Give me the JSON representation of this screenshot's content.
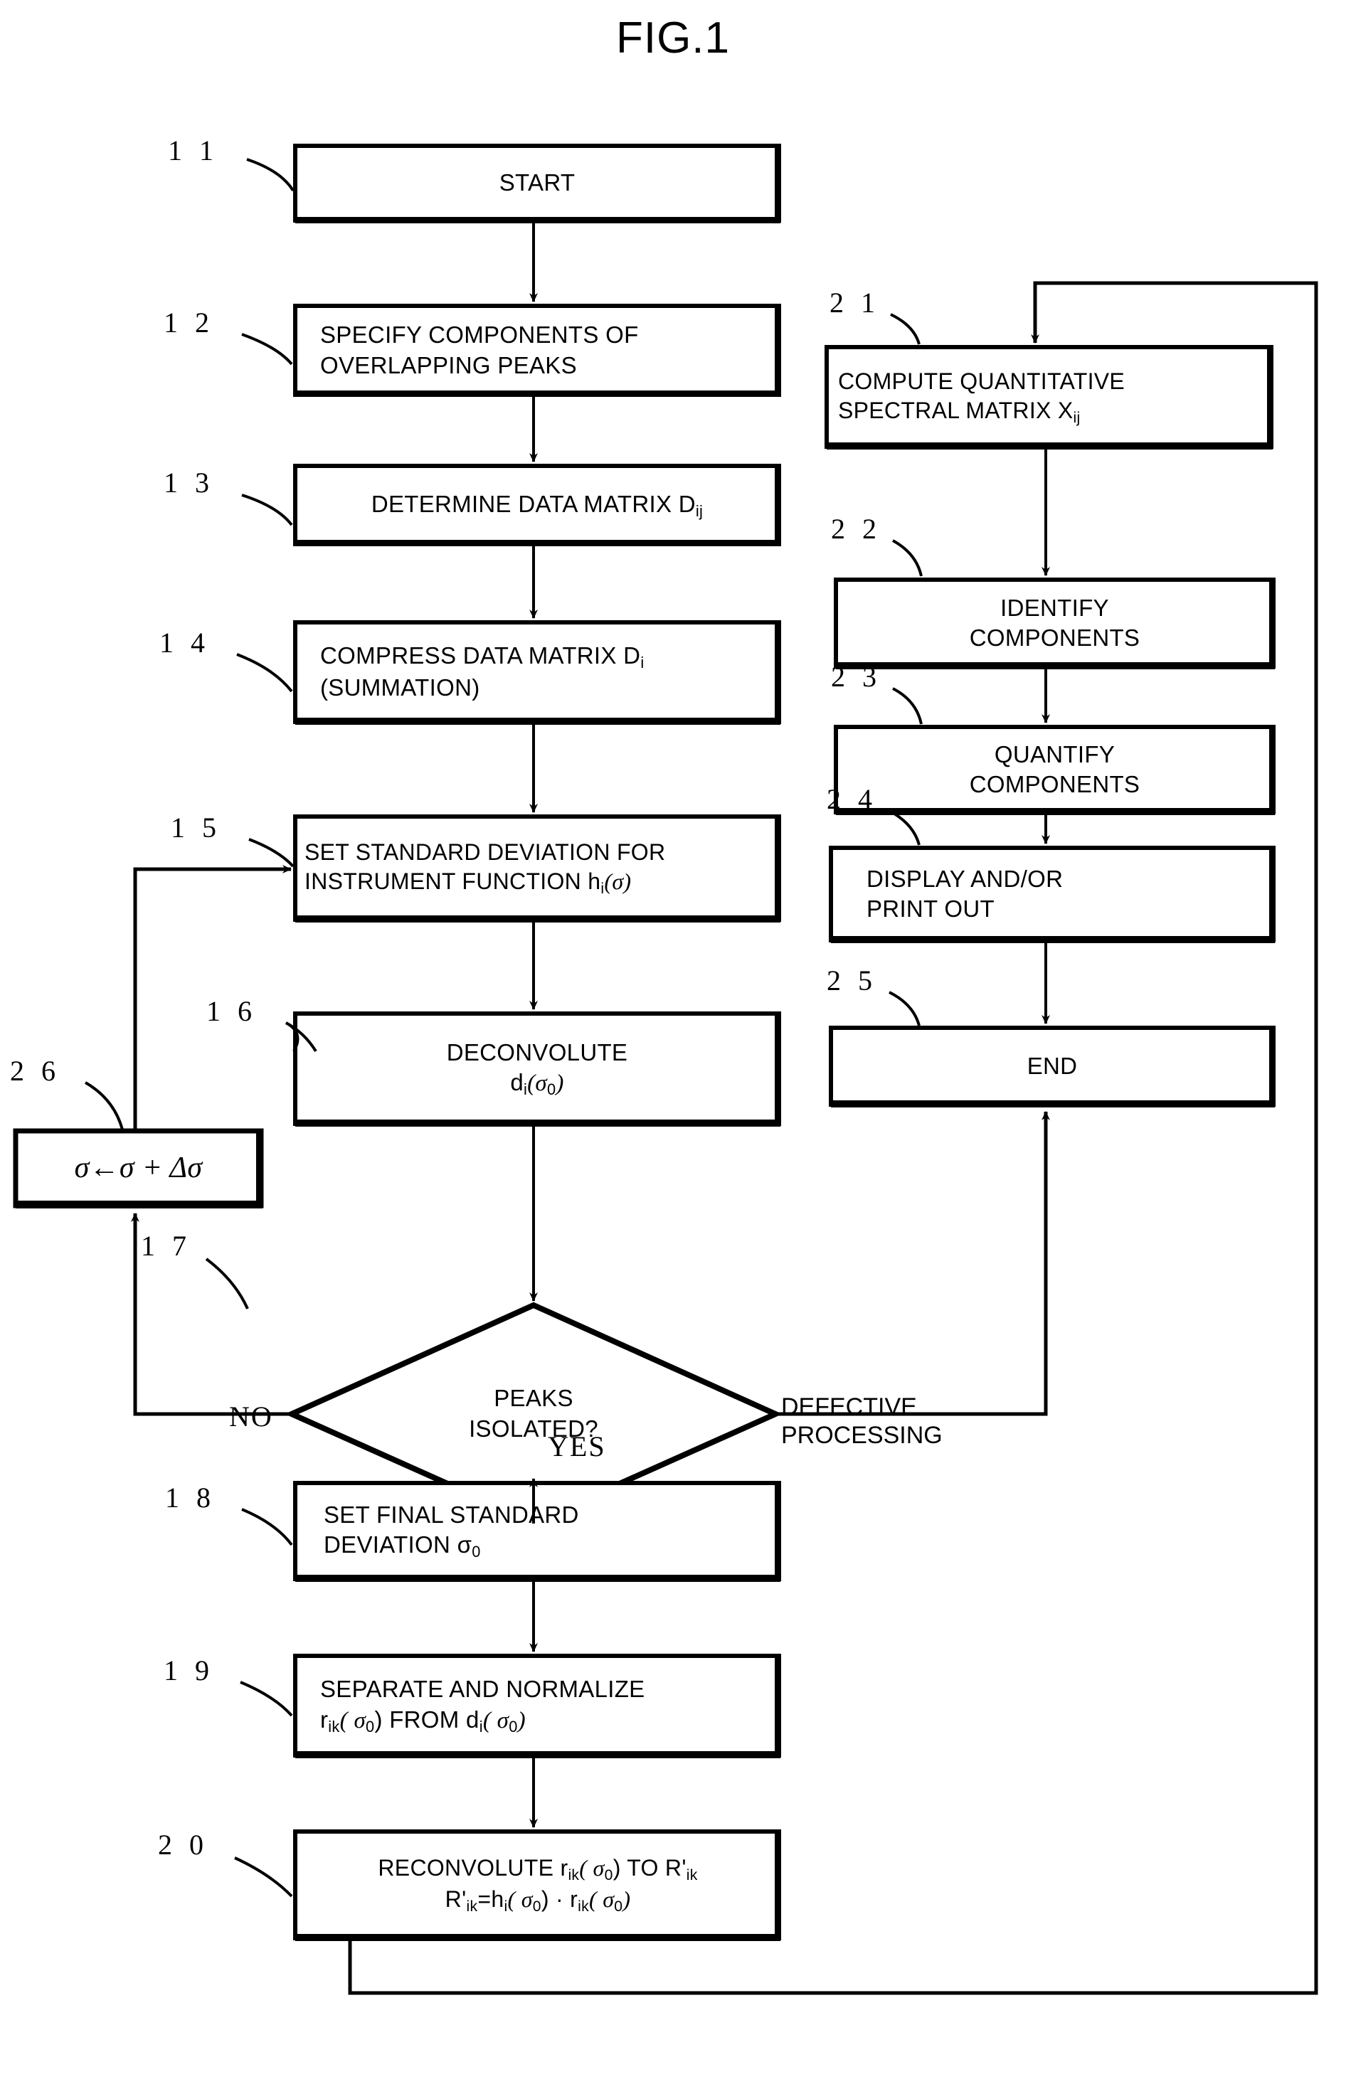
{
  "figure": {
    "title": "FIG.1",
    "type": "patent-flowchart"
  },
  "nodes": {
    "n11": {
      "ref": "1 1",
      "lines": [
        "START"
      ]
    },
    "n12": {
      "ref": "1 2",
      "lines": [
        "SPECIFY COMPONENTS OF",
        "OVERLAPPING PEAKS"
      ]
    },
    "n13": {
      "ref": "1 3",
      "lines": [
        "DETERMINE DATA MATRIX D",
        "ij"
      ]
    },
    "n14": {
      "ref": "1 4",
      "lines": [
        "COMPRESS DATA MATRIX D",
        "i",
        "(SUMMATION)"
      ]
    },
    "n15": {
      "ref": "1 5",
      "lines": [
        "SET STANDARD DEVIATION FOR",
        "INSTRUMENT FUNCTION h",
        "i",
        "(σ)"
      ]
    },
    "n16": {
      "ref": "1 6",
      "lines": [
        "DECONVOLUTE",
        "d",
        "i",
        "(σ",
        "0",
        ")"
      ]
    },
    "n17": {
      "ref": "1 7",
      "lines": [
        "PEAKS",
        "ISOLATED?"
      ]
    },
    "n18": {
      "ref": "1 8",
      "lines": [
        "SET FINAL STANDARD",
        "DEVIATION σ",
        "0"
      ]
    },
    "n19": {
      "ref": "1 9",
      "lines": [
        "SEPARATE AND NORMALIZE",
        "r",
        "ik",
        "( σ",
        "0",
        ") FROM d",
        "i",
        "( σ",
        "0",
        ")"
      ]
    },
    "n20": {
      "ref": "2 0",
      "lines": [
        "RECONVOLUTE r",
        "ik",
        "( σ",
        "0",
        ") TO R'",
        "ik",
        "R'",
        "ik",
        "=h",
        "i",
        "( σ",
        "0",
        ") · r",
        "ik",
        "( σ",
        "0",
        ")"
      ]
    },
    "n21": {
      "ref": "2 1",
      "lines": [
        "COMPUTE QUANTITATIVE",
        "SPECTRAL MATRIX X",
        "ij"
      ]
    },
    "n22": {
      "ref": "2 2",
      "lines": [
        "IDENTIFY",
        "COMPONENTS"
      ]
    },
    "n23": {
      "ref": "2 3",
      "lines": [
        "QUANTIFY",
        "COMPONENTS"
      ]
    },
    "n24": {
      "ref": "2 4",
      "lines": [
        "DISPLAY AND/OR",
        "PRINT OUT"
      ]
    },
    "n25": {
      "ref": "2 5",
      "lines": [
        "END"
      ]
    },
    "n26": {
      "ref": "2 6",
      "lines": [
        "σ←σ + Δσ"
      ]
    }
  },
  "text": {
    "start": "START",
    "specify_l1": "SPECIFY COMPONENTS OF",
    "specify_l2": "OVERLAPPING PEAKS",
    "determine_l1": "DETERMINE DATA MATRIX D",
    "determine_sub": "ij",
    "compress_l1": "COMPRESS DATA MATRIX D",
    "compress_sub": "i",
    "compress_l2": "(SUMMATION)",
    "setstd_l1": "SET STANDARD DEVIATION FOR",
    "setstd_l2a": "INSTRUMENT FUNCTION h",
    "setstd_l2sub": "i",
    "setstd_l2b": "(σ)",
    "deconv_l1": "DECONVOLUTE",
    "deconv_l2a": "d",
    "deconv_l2sub1": "i",
    "deconv_l2b": "(σ",
    "deconv_l2sub2": "0",
    "deconv_l2c": ")",
    "peaks_l1": "PEAKS",
    "peaks_l2": "ISOLATED?",
    "setfinal_l1": "SET FINAL STANDARD",
    "setfinal_l2a": "DEVIATION  σ",
    "setfinal_l2sub": "0",
    "separate_l1": "SEPARATE AND NORMALIZE",
    "separate_l2a": "r",
    "separate_l2sub1": "ik",
    "separate_l2b": "( σ",
    "separate_l2sub2": "0",
    "separate_l2c": ") FROM d",
    "separate_l2sub3": "i",
    "separate_l2d": "( σ",
    "separate_l2sub4": "0",
    "separate_l2e": ")",
    "recon_l1a": "RECONVOLUTE r",
    "recon_l1sub1": "ik",
    "recon_l1b": "( σ",
    "recon_l1sub2": "0",
    "recon_l1c": ") TO R'",
    "recon_l1sub3": "ik",
    "recon_l2a": "R'",
    "recon_l2sub1": "ik",
    "recon_l2b": "=h",
    "recon_l2sub2": "i",
    "recon_l2c": "( σ",
    "recon_l2sub3": "0",
    "recon_l2d": ") · r",
    "recon_l2sub4": "ik",
    "recon_l2e": "( σ",
    "recon_l2sub5": "0",
    "recon_l2f": ")",
    "compute_l1": "COMPUTE QUANTITATIVE",
    "compute_l2a": "SPECTRAL MATRIX X",
    "compute_l2sub": "ij",
    "identify_l1": "IDENTIFY",
    "identify_l2": "COMPONENTS",
    "quantify_l1": "QUANTIFY",
    "quantify_l2": "COMPONENTS",
    "display_l1": "DISPLAY AND/OR",
    "display_l2": "PRINT OUT",
    "end": "END",
    "increment": "σ←σ + Δσ"
  },
  "edges": {
    "no_label": "NO",
    "yes_label": "YES",
    "defective_l1": "DEFECTIVE",
    "defective_l2": "PROCESSING"
  },
  "refs": {
    "r11": "1 1",
    "r12": "1 2",
    "r13": "1 3",
    "r14": "1 4",
    "r15": "1 5",
    "r16": "1 6",
    "r17": "1 7",
    "r18": "1 8",
    "r19": "1 9",
    "r20": "2 0",
    "r21": "2 1",
    "r22": "2 2",
    "r23": "2 3",
    "r24": "2 4",
    "r25": "2 5",
    "r26": "2 6"
  },
  "colors": {
    "ink": "#000000",
    "paper": "#ffffff"
  }
}
